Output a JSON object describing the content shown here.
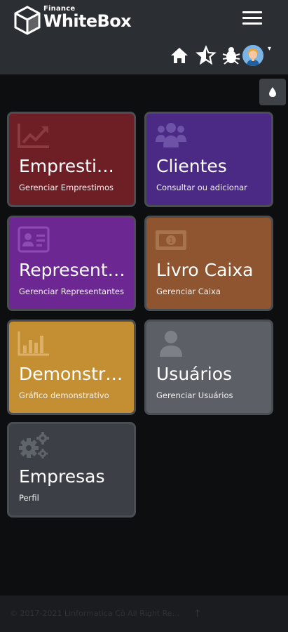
{
  "brand": {
    "small": "Finance",
    "name": "WhiteBox"
  },
  "header": {
    "menu_icon": "hamburger-icon",
    "icons": [
      "home-icon",
      "star-half-icon",
      "bug-icon",
      "user-avatar",
      "caret-down-icon"
    ]
  },
  "theme_toggle": {
    "icon": "droplet-icon"
  },
  "tiles": [
    {
      "title": "Emprestimos",
      "subtitle": "Gerenciar Emprestimos",
      "icon": "chart-line-icon",
      "color": "#6e1e25"
    },
    {
      "title": "Clientes",
      "subtitle": "Consultar ou adicionar",
      "icon": "users-icon",
      "color": "#4b2a86"
    },
    {
      "title": "Representantes",
      "subtitle": "Gerenciar Representantes",
      "icon": "id-card-icon",
      "color": "#6c2792"
    },
    {
      "title": "Livro Caixa",
      "subtitle": "Gerenciar Caixa",
      "icon": "money-bill-icon",
      "color": "#8e5530"
    },
    {
      "title": "Demonstrativo",
      "subtitle": "Gráfico demonstrativo",
      "icon": "bar-chart-icon",
      "color": "#c48f33"
    },
    {
      "title": "Usuários",
      "subtitle": "Gerenciar Usuários",
      "icon": "user-icon",
      "color": "#5c6066"
    },
    {
      "title": "Empresas",
      "subtitle": "Perfil",
      "icon": "gears-icon",
      "color": "#3c4046"
    }
  ],
  "footer": {
    "text": "© 2017-2021 Linformatica Cô All Right Re...",
    "arrow": "arrow-up-icon"
  }
}
